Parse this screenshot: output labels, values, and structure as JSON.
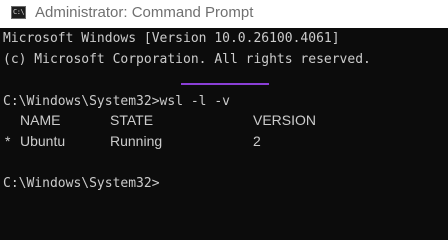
{
  "window": {
    "title": "Administrator: Command Prompt",
    "icon": "command-prompt-icon",
    "icon_glyph": "C:\\"
  },
  "console": {
    "banner_line1": "Microsoft Windows [Version 10.0.26100.4061]",
    "banner_line2": "(c) Microsoft Corporation. All rights reserved.",
    "prompt1": "C:\\Windows\\System32>",
    "command": "wsl -l -v",
    "table": {
      "headers": [
        "NAME",
        "STATE",
        "VERSION"
      ],
      "rows": [
        {
          "marker": "*",
          "name": "Ubuntu",
          "state": "Running",
          "version": "2"
        }
      ]
    },
    "prompt2": "C:\\Windows\\System32>"
  },
  "colors": {
    "background": "#0c0c0c",
    "text": "#cccccc",
    "titlebar": "#ffffff",
    "title_text": "#707070",
    "highlight_underline": "#8a3fd6"
  }
}
